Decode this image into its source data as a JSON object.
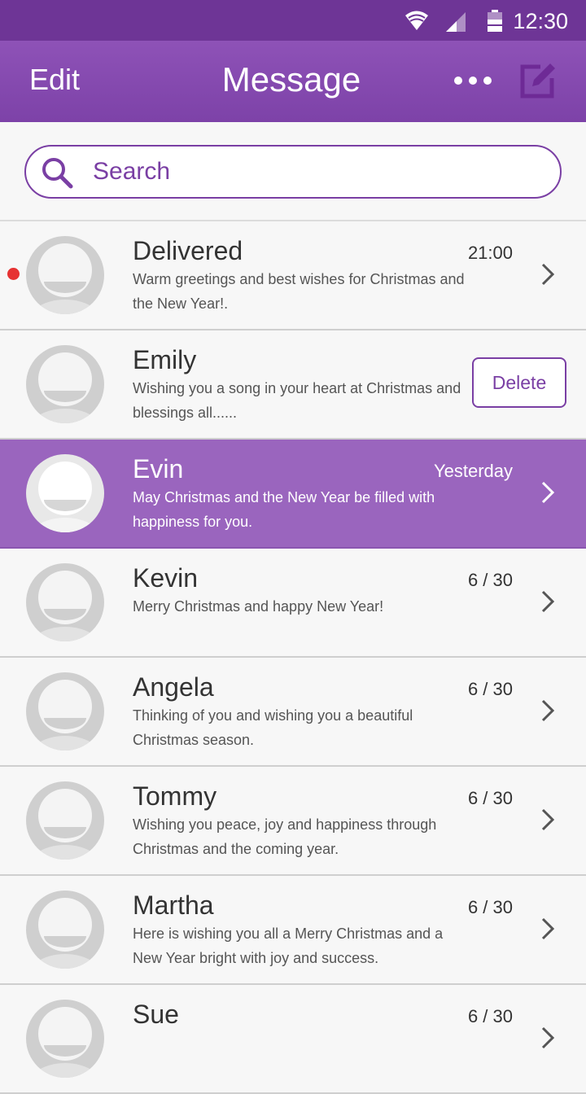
{
  "status_bar": {
    "time": "12:30",
    "icons": [
      "wifi-icon",
      "signal-icon",
      "battery-icon"
    ]
  },
  "header": {
    "edit_label": "Edit",
    "title": "Message",
    "more_icon": "more-icon",
    "compose_icon": "compose-icon"
  },
  "search": {
    "placeholder": "Search"
  },
  "colors": {
    "accent": "#7d42a8",
    "status_bar": "#6e3596",
    "selected_row": "#9a65be",
    "unread_dot": "#e63232"
  },
  "messages": [
    {
      "name": "Delivered",
      "time": "21:00",
      "preview": "Warm greetings and best wishes for Christmas and the New Year!."
    },
    {
      "name": "Emily",
      "preview": "Wishing you a song in your heart at Christmas and blessings all......",
      "action_label": "Delete"
    },
    {
      "name": "Evin",
      "time": "Yesterday",
      "preview": "May Christmas and the New Year be filled with happiness for you."
    },
    {
      "name": "Kevin",
      "time": "6 / 30",
      "preview": "Merry Christmas and happy New Year!"
    },
    {
      "name": "Angela",
      "time": "6 / 30",
      "preview": "Thinking of you and wishing you a beautiful Christmas season."
    },
    {
      "name": "Tommy",
      "time": "6 / 30",
      "preview": "Wishing you peace, joy and happiness through Christmas and the coming year."
    },
    {
      "name": "Martha",
      "time": "6 / 30",
      "preview": "Here is wishing you all a Merry Christmas and a New Year bright with joy and success."
    },
    {
      "name": "Sue",
      "time": "6 / 30",
      "preview": ""
    }
  ]
}
